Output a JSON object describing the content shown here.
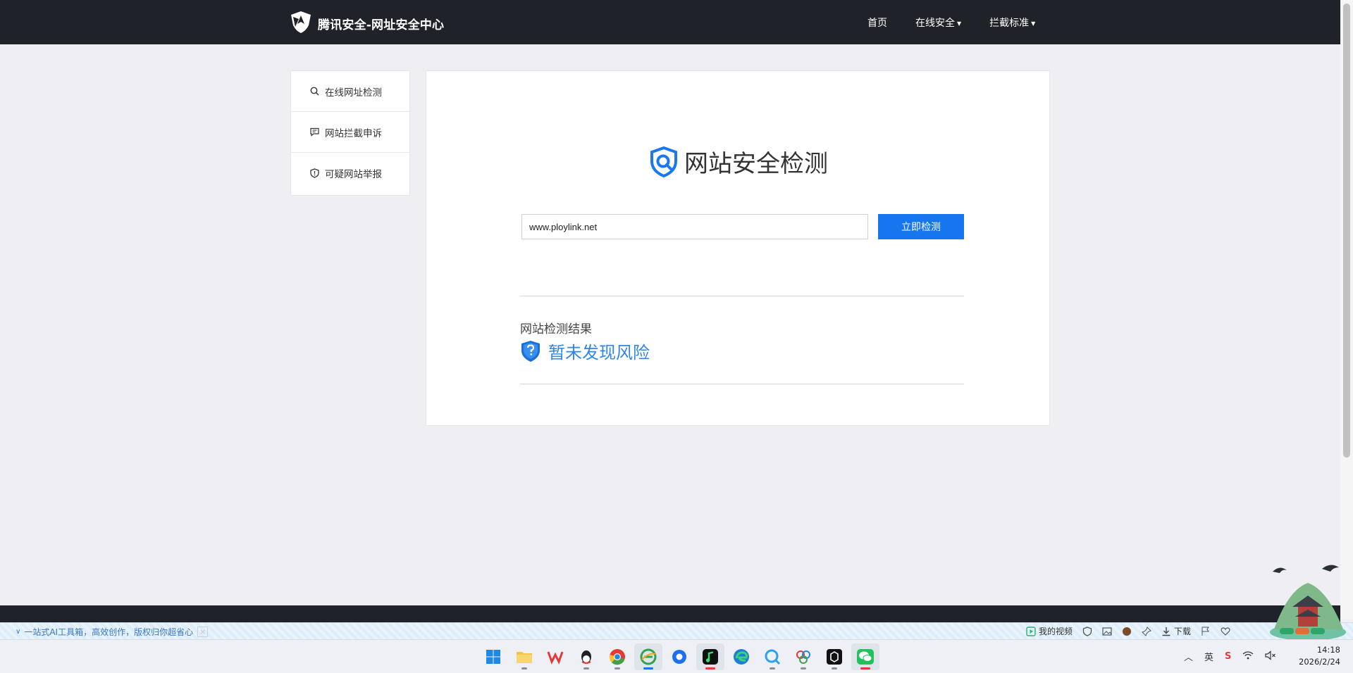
{
  "header": {
    "brand_title": "腾讯安全-网址安全中心",
    "nav": [
      {
        "label": "首页",
        "dropdown": false
      },
      {
        "label": "在线安全",
        "dropdown": true
      },
      {
        "label": "拦截标准",
        "dropdown": true
      }
    ]
  },
  "sidebar": {
    "items": [
      {
        "label": "在线网址检测",
        "icon": "search-icon"
      },
      {
        "label": "网站拦截申诉",
        "icon": "message-icon"
      },
      {
        "label": "可疑网站举报",
        "icon": "shield-icon"
      }
    ]
  },
  "main": {
    "title": "网站安全检测",
    "url_input_value": "www.ploylink.net",
    "check_button": "立即检测",
    "result_label": "网站检测结果",
    "result_status": "暂未发现风险"
  },
  "statusbar": {
    "promo_text": "一站式AI工具箱，高效创作，版权归你超省心",
    "close_label": "×",
    "video_label": "我的视频",
    "download_label": "下载"
  },
  "taskbar": {
    "apps": [
      "windows-start-icon",
      "file-explorer-icon",
      "wps-icon",
      "qq-icon",
      "chrome-icon",
      "browser-icon",
      "bubble-app-icon",
      "music-app-icon",
      "edge-icon",
      "search-app-icon",
      "cloud-app-icon",
      "terminal-app-icon",
      "wechat-icon"
    ],
    "tray": {
      "input_lang": "英",
      "ime_label": "S",
      "time": "14:18",
      "date": "2026/2/24"
    }
  },
  "colors": {
    "nav_bg": "#1f2229",
    "accent_blue": "#1676ee",
    "result_blue": "#2f86e8",
    "page_bg": "#efeff3"
  }
}
